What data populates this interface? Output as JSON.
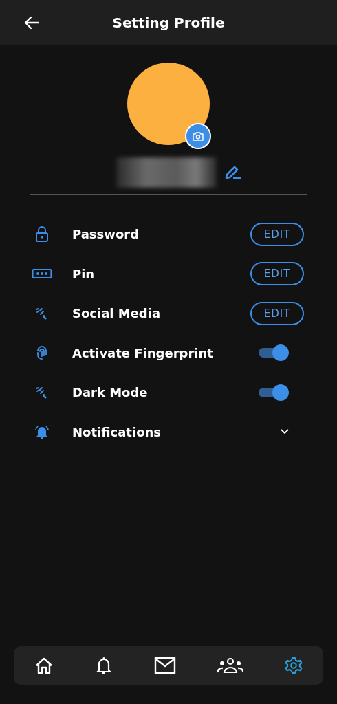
{
  "header": {
    "title": "Setting Profile"
  },
  "settings": [
    {
      "kind": "edit",
      "label": "Password",
      "button": "EDIT"
    },
    {
      "kind": "edit",
      "label": "Pin",
      "button": "EDIT"
    },
    {
      "kind": "edit",
      "label": "Social Media",
      "button": "EDIT"
    },
    {
      "kind": "toggle",
      "label": "Activate Fingerprint",
      "on": true
    },
    {
      "kind": "toggle",
      "label": "Dark Mode",
      "on": true
    },
    {
      "kind": "expand",
      "label": "Notifications",
      "expanded": false
    }
  ],
  "nav": [
    {
      "selected": false
    },
    {
      "selected": false
    },
    {
      "selected": false
    },
    {
      "selected": false
    },
    {
      "selected": true
    }
  ]
}
